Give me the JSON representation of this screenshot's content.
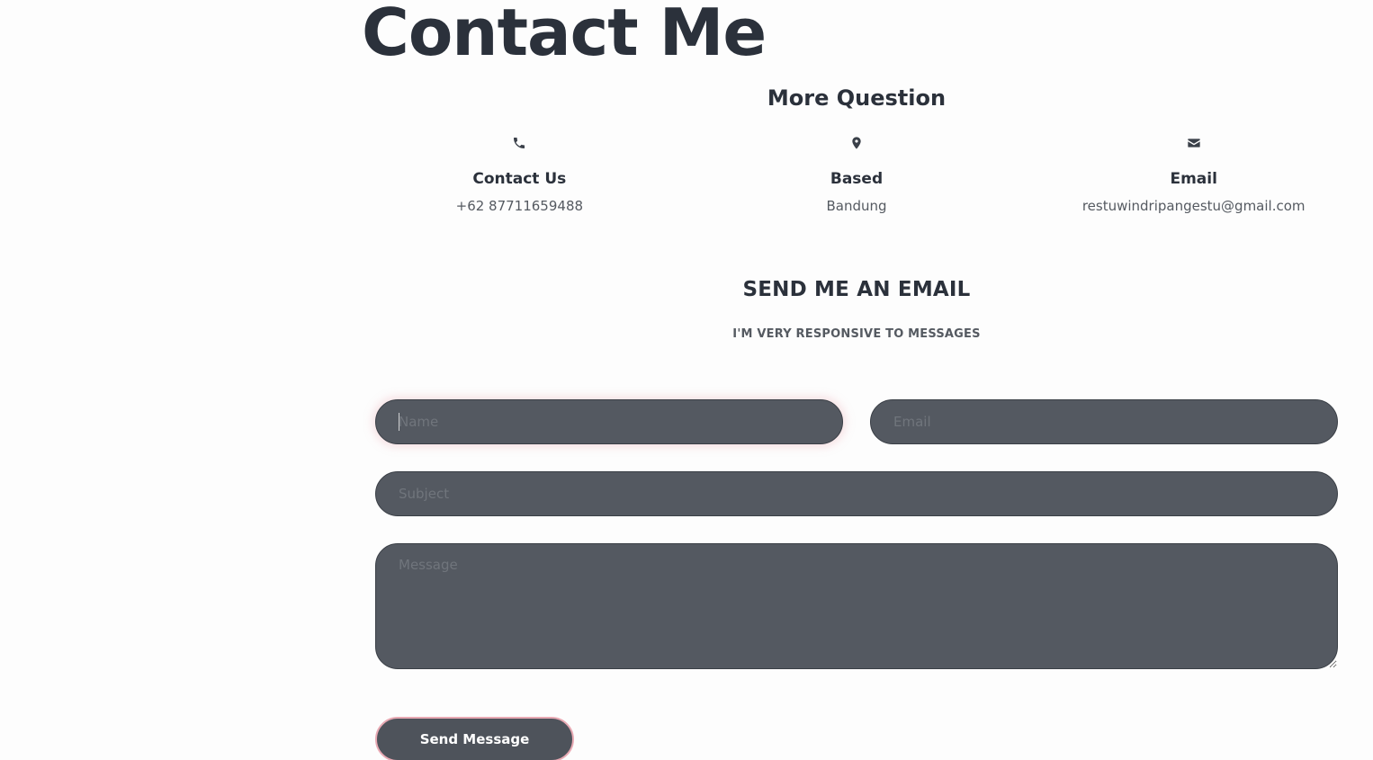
{
  "header": {
    "title": "Contact Me"
  },
  "info": {
    "heading": "More Question",
    "items": [
      {
        "icon": "phone-icon",
        "title": "Contact Us",
        "value": "+62 87711659488"
      },
      {
        "icon": "map-pin-icon",
        "title": "Based",
        "value": "Bandung"
      },
      {
        "icon": "envelope-icon",
        "title": "Email",
        "value": "restuwindripangestu@gmail.com"
      }
    ]
  },
  "form": {
    "heading": "SEND ME AN EMAIL",
    "subheading": "I'M VERY RESPONSIVE TO MESSAGES",
    "name_placeholder": "Name",
    "name_value": "",
    "email_placeholder": "Email",
    "email_value": "",
    "subject_placeholder": "Subject",
    "subject_value": "",
    "message_placeholder": "Message",
    "message_value": "",
    "submit_label": "Send Message"
  },
  "colors": {
    "background": "#fdfdfd",
    "heading_text": "#2b313b",
    "field_background": "#545961",
    "button_border_accent": "#e8a9b3"
  }
}
